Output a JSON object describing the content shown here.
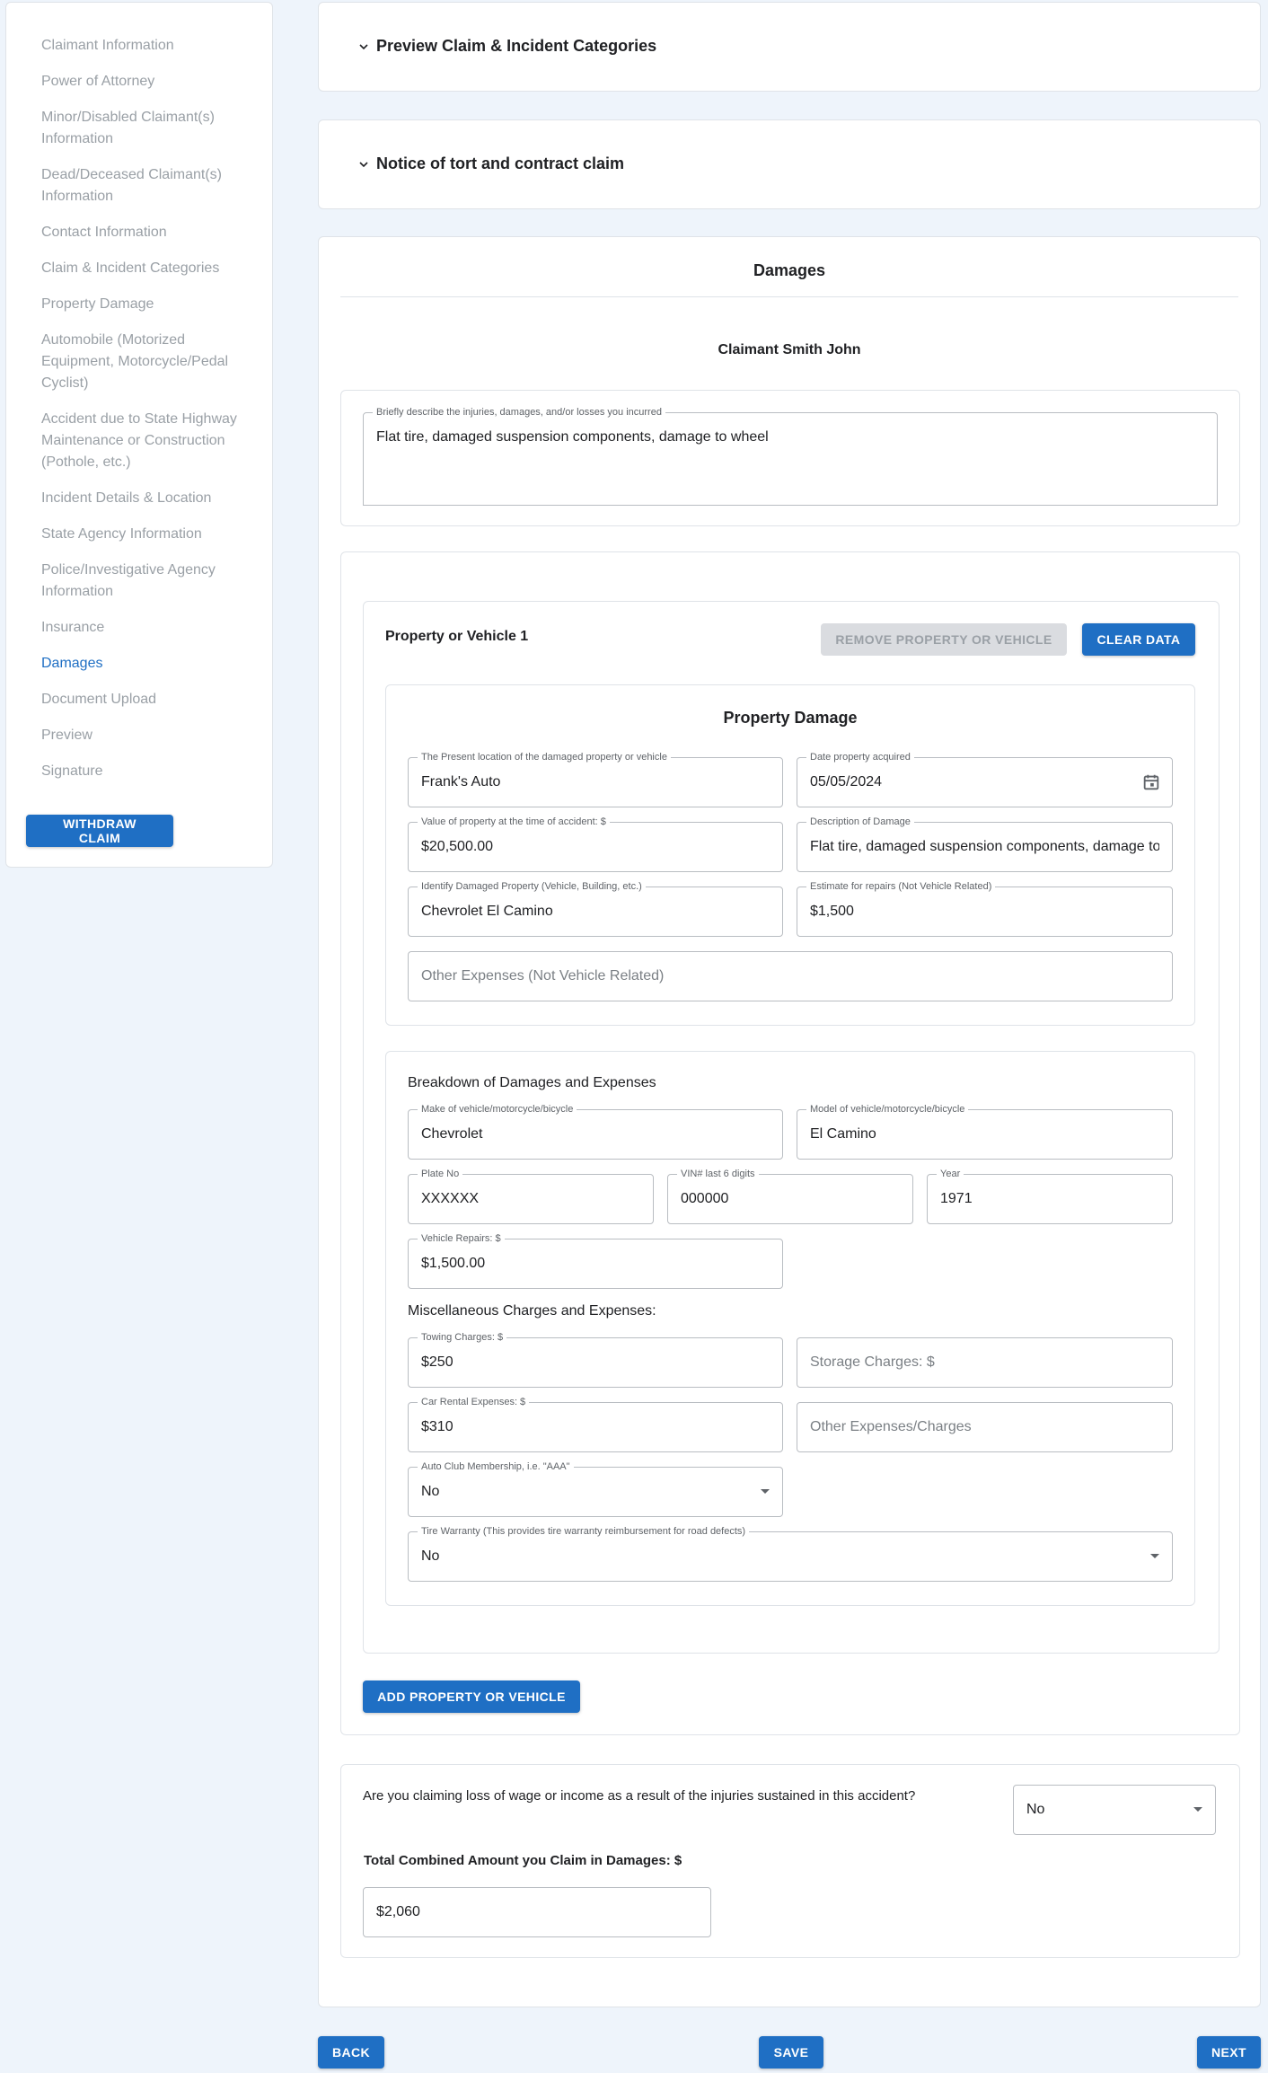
{
  "sidebar": {
    "items": [
      {
        "label": "Claimant Information",
        "active": false
      },
      {
        "label": "Power of Attorney",
        "active": false
      },
      {
        "label": "Minor/Disabled Claimant(s) Information",
        "active": false
      },
      {
        "label": "Dead/Deceased Claimant(s) Information",
        "active": false
      },
      {
        "label": "Contact Information",
        "active": false
      },
      {
        "label": "Claim & Incident Categories",
        "active": false
      },
      {
        "label": "Property Damage",
        "active": false
      },
      {
        "label": "Automobile (Motorized Equipment, Motorcycle/Pedal Cyclist)",
        "active": false
      },
      {
        "label": "Accident due to State Highway Maintenance or Construction (Pothole, etc.)",
        "active": false
      },
      {
        "label": "Incident Details & Location",
        "active": false
      },
      {
        "label": "State Agency Information",
        "active": false
      },
      {
        "label": "Police/Investigative Agency Information",
        "active": false
      },
      {
        "label": "Insurance",
        "active": false
      },
      {
        "label": "Damages",
        "active": true
      },
      {
        "label": "Document Upload",
        "active": false
      },
      {
        "label": "Preview",
        "active": false
      },
      {
        "label": "Signature",
        "active": false
      }
    ],
    "withdraw_label": "WITHDRAW CLAIM"
  },
  "accordions": {
    "preview": "Preview Claim & Incident Categories",
    "notice": "Notice of tort and contract claim"
  },
  "damages": {
    "title": "Damages",
    "claimant": "Claimant Smith John",
    "description_label": "Briefly describe the injuries, damages, and/or losses you incurred",
    "description_value": "Flat tire, damaged suspension components, damage to wheel",
    "property": {
      "title": "Property or Vehicle 1",
      "remove_label": "REMOVE PROPERTY OR VEHICLE",
      "clear_label": "CLEAR DATA",
      "pd_title": "Property Damage",
      "location": {
        "label": "The Present location of the damaged property or vehicle",
        "value": "Frank's Auto"
      },
      "date_acquired": {
        "label": "Date property acquired",
        "value": "05/05/2024"
      },
      "value": {
        "label": "Value of property at the time of accident: $",
        "value": "$20,500.00"
      },
      "description": {
        "label": "Description of Damage",
        "value": "Flat tire, damaged suspension components, damage to wheel"
      },
      "identify": {
        "label": "Identify Damaged Property (Vehicle, Building, etc.)",
        "value": "Chevrolet El Camino"
      },
      "estimate": {
        "label": "Estimate for repairs (Not Vehicle Related)",
        "value": "$1,500"
      },
      "other_expenses_placeholder": "Other Expenses (Not Vehicle Related)",
      "breakdown_title": "Breakdown of Damages and Expenses",
      "make": {
        "label": "Make of vehicle/motorcycle/bicycle",
        "value": "Chevrolet"
      },
      "model": {
        "label": "Model of vehicle/motorcycle/bicycle",
        "value": "El Camino"
      },
      "plate": {
        "label": "Plate No",
        "value": "XXXXXX"
      },
      "vin": {
        "label": "VIN# last 6 digits",
        "value": "000000"
      },
      "year": {
        "label": "Year",
        "value": "1971"
      },
      "repairs": {
        "label": "Vehicle Repairs: $",
        "value": "$1,500.00"
      },
      "misc_title": "Miscellaneous Charges and Expenses:",
      "towing": {
        "label": "Towing Charges: $",
        "value": "$250"
      },
      "storage_placeholder": "Storage Charges: $",
      "rental": {
        "label": "Car Rental Expenses: $",
        "value": "$310"
      },
      "other_charges_placeholder": "Other Expenses/Charges",
      "auto_club": {
        "label": "Auto Club Membership, i.e. \"AAA\"",
        "value": "No"
      },
      "tire": {
        "label": "Tire Warranty (This provides tire warranty reimbursement for road defects)",
        "value": "No"
      }
    },
    "add_label": "ADD PROPERTY OR VEHICLE",
    "wage_question": "Are you claiming loss of wage or income as a result of the injuries sustained in this accident?",
    "wage_value": "No",
    "total_label": "Total Combined Amount you Claim in Damages: $",
    "total_value": "$2,060"
  },
  "footer": {
    "back": "BACK",
    "save": "SAVE",
    "next": "NEXT"
  },
  "colors": {
    "accent": "#1f6fc4",
    "page_bg": "#eef4fb"
  }
}
